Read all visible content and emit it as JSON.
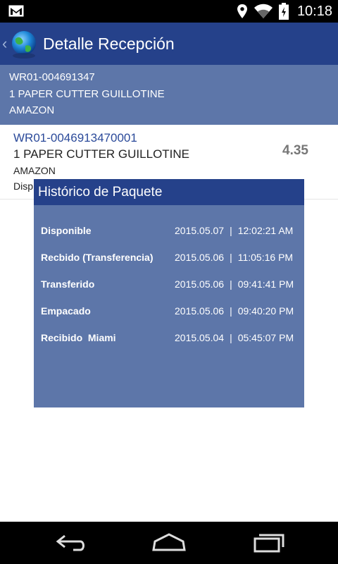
{
  "status_bar": {
    "time": "10:18",
    "icons": [
      "gmail-icon",
      "location-icon",
      "wifi-icon",
      "battery-charging-icon"
    ]
  },
  "action_bar": {
    "title": "Detalle Recepción",
    "nav_icon": "chevron-left-icon",
    "logo_icon": "globe-logo-icon"
  },
  "header": {
    "tracking": "WR01-004691347",
    "description": "1 PAPER CUTTER GUILLOTINE",
    "vendor": "AMAZON"
  },
  "list": {
    "items": [
      {
        "tracking": "WR01-0046913470001",
        "description": "1 PAPER CUTTER GUILLOTINE",
        "vendor": "AMAZON",
        "status": "Disp",
        "amount": "4.35"
      }
    ]
  },
  "dialog": {
    "title": "Histórico de Paquete",
    "rows": [
      {
        "status": "Disponible",
        "date": "2015.05.07",
        "time": "12:02:21 AM"
      },
      {
        "status": "Recbido (Transferencia)",
        "date": "2015.05.06",
        "time": "11:05:16 PM"
      },
      {
        "status": "Transferido",
        "date": "2015.05.06",
        "time": "09:41:41 PM"
      },
      {
        "status": "Empacado",
        "date": "2015.05.06",
        "time": "09:40:20 PM"
      },
      {
        "status": "Recibido  Miami",
        "date": "2015.05.04",
        "time": "05:45:07 PM"
      }
    ],
    "separator": "|"
  },
  "nav_bar": {
    "buttons": [
      "back-icon",
      "home-icon",
      "recent-apps-icon"
    ]
  },
  "colors": {
    "action_bar": "#25418a",
    "panel": "#5d76a9",
    "tracking_text": "#2b4a9a",
    "amount_text": "#777777"
  }
}
